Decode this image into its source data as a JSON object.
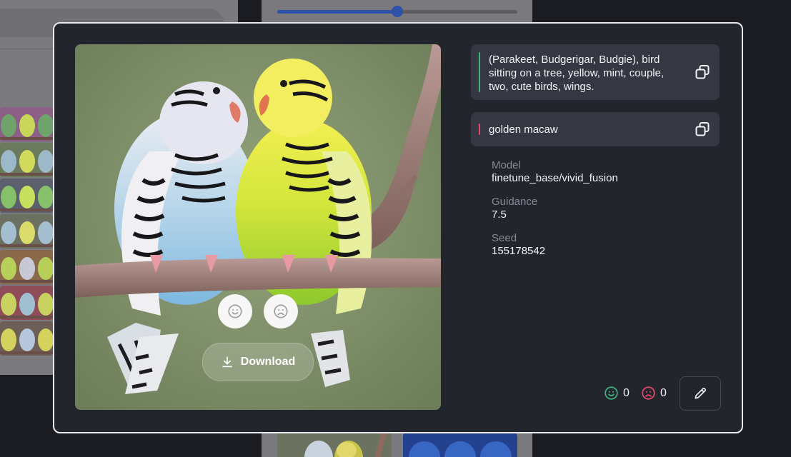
{
  "colors": {
    "modal_bg": "#23252d",
    "card_bg": "#353843",
    "positive_accent": "#3fb27f",
    "negative_accent": "#e5496a",
    "slider_accent": "#2d52a8"
  },
  "icons": {
    "like": "smile-face-icon",
    "dislike": "frown-face-icon",
    "download": "download-icon",
    "copy": "copy-icon",
    "edit": "pencil-icon"
  },
  "background": {
    "slider_value": 0.5
  },
  "image": {
    "download_label": "Download"
  },
  "prompt": {
    "positive": "(Parakeet, Budgerigar, Budgie), bird sitting on a tree, yellow, mint, couple, two, cute birds, wings.",
    "negative": "golden macaw"
  },
  "details": {
    "model_label": "Model",
    "model_value": "finetune_base/vivid_fusion",
    "guidance_label": "Guidance",
    "guidance_value": "7.5",
    "seed_label": "Seed",
    "seed_value": "155178542"
  },
  "ratings": {
    "likes": "0",
    "dislikes": "0"
  }
}
